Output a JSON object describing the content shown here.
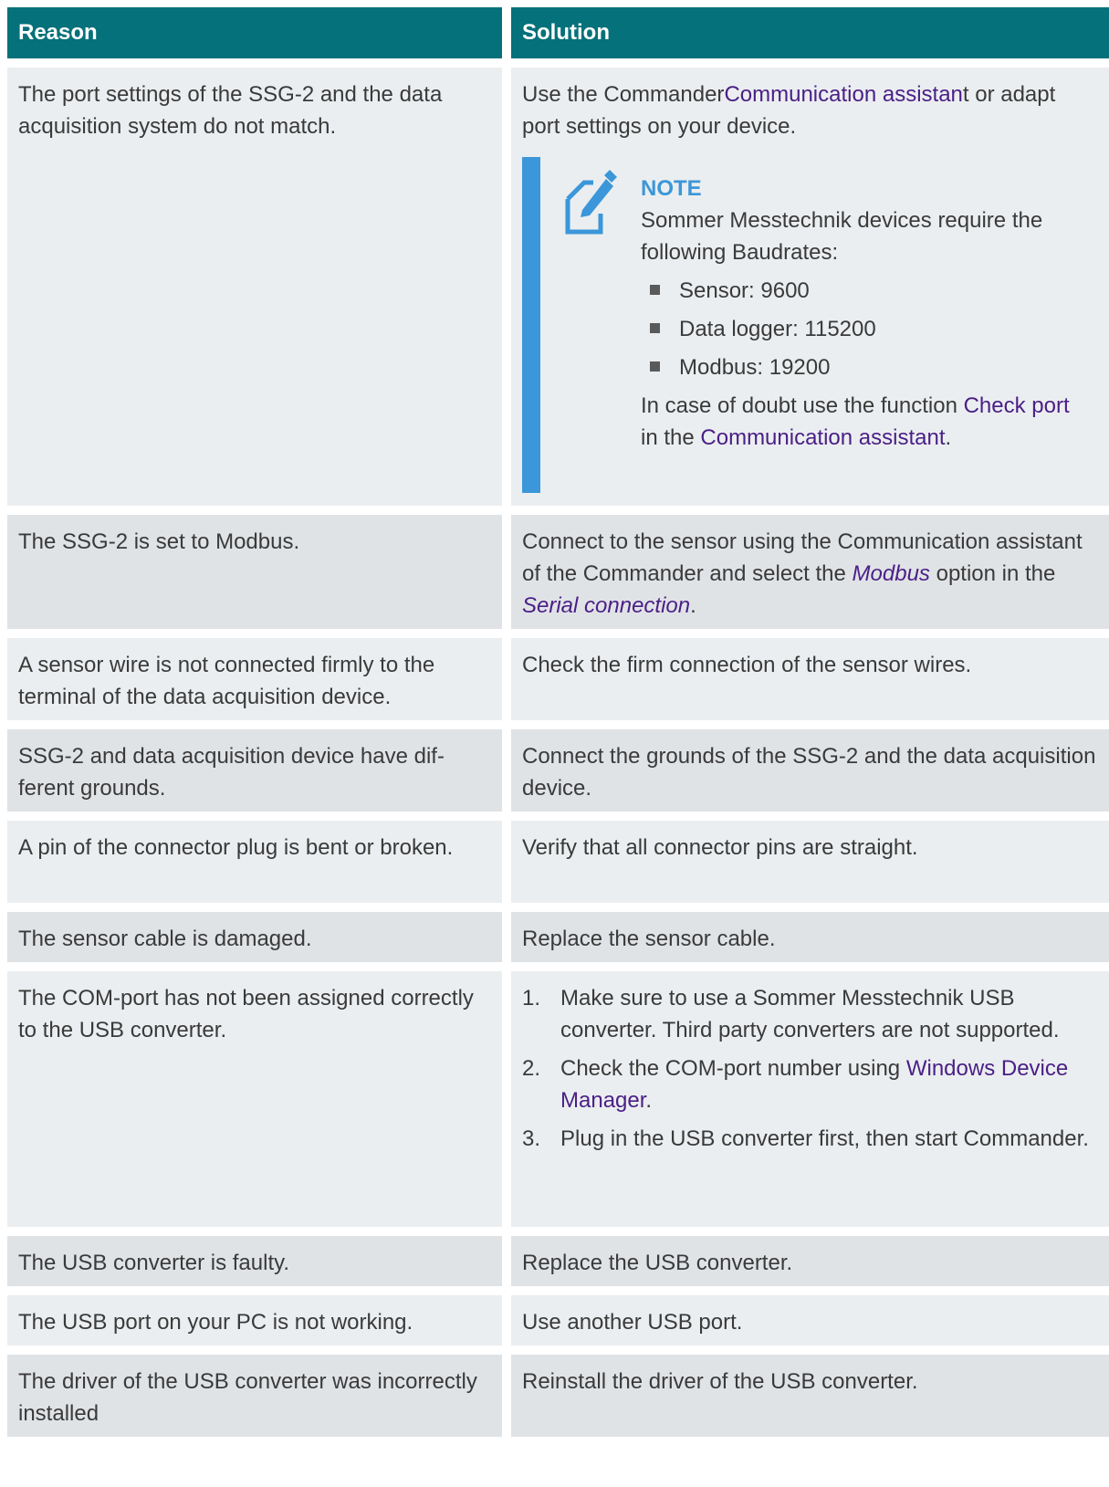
{
  "header": {
    "reason": "Reason",
    "solution": "Solution"
  },
  "rows": [
    {
      "reason": "The port settings of the SSG-2 and the data acquisition system do not match.",
      "solution": {
        "pre": "Use the Commander",
        "link": "Communication assistan",
        "post": "t or adapt port settings on your device."
      },
      "note": {
        "icon": "note-icon",
        "title": "NOTE",
        "text": "Sommer Messtechnik devices require the following Baudrates:",
        "bullets": [
          "Sensor: 9600",
          "Data logger: 115200",
          "Modbus: 19200"
        ],
        "doubt_pre": "In case of doubt use the function ",
        "doubt_link1": "Check port",
        "doubt_mid": " in the ",
        "doubt_link2": "Communication assistant",
        "doubt_post": "."
      }
    },
    {
      "reason": "The SSG-2 is set to Modbus.",
      "solution": {
        "pre": "Connect to the sensor using the Communication assistant of the Commander and select the ",
        "link": "Modbus",
        "mid": " option in the ",
        "link2": "Serial connection",
        "post": "."
      }
    },
    {
      "reason": "A sensor wire is not connected firmly to the terminal of the data acquisition device.",
      "solution": "Check the firm connection of the sensor wires."
    },
    {
      "reason": "SSG-2 and data acquisition device have dif­ferent grounds.",
      "solution": "Connect the grounds of the SSG-2 and the data acquisition device."
    },
    {
      "reason": "A pin of the connector plug is bent or broken.",
      "solution": "Verify that all connector pins are straight."
    },
    {
      "reason": "The sensor cable is damaged.",
      "solution": "Replace the sensor cable."
    },
    {
      "reason": "The COM-port has not been assigned cor­rectly to the USB converter.",
      "steps": [
        {
          "num": "1.",
          "text": "Make sure to use a Sommer Messtechnik USB converter. Third party converters are not sup­ported."
        },
        {
          "num": "2.",
          "text": "Check the COM-port number using ",
          "link": "Windows Device Manager",
          "post": "."
        },
        {
          "num": "3.",
          "text": "Plug in the USB converter first, then start Com­mander."
        }
      ]
    },
    {
      "reason": "The USB converter is faulty.",
      "solution": "Replace the USB converter."
    },
    {
      "reason": "The USB port on your PC is not working.",
      "solution": "Use another USB port."
    },
    {
      "reason": "The driver of the USB converter was incor­rectly installed",
      "solution": "Reinstall the driver of the USB converter."
    }
  ],
  "colors": {
    "header": "#05717a",
    "note_accent": "#3b97d9",
    "link": "#4a1f86"
  }
}
